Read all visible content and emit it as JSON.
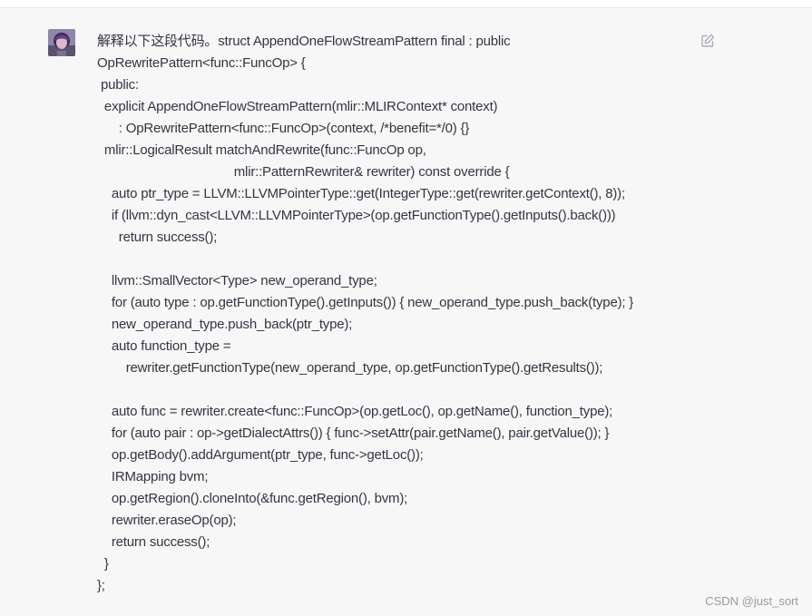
{
  "message": {
    "lines": [
      "解释以下这段代码。struct AppendOneFlowStreamPattern final : public",
      "OpRewritePattern<func::FuncOp> {",
      " public:",
      "  explicit AppendOneFlowStreamPattern(mlir::MLIRContext* context)",
      "      : OpRewritePattern<func::FuncOp>(context, /*benefit=*/0) {}",
      "  mlir::LogicalResult matchAndRewrite(func::FuncOp op,",
      "                                      mlir::PatternRewriter& rewriter) const override {",
      "    auto ptr_type = LLVM::LLVMPointerType::get(IntegerType::get(rewriter.getContext(), 8));",
      "    if (llvm::dyn_cast<LLVM::LLVMPointerType>(op.getFunctionType().getInputs().back()))",
      "      return success();",
      "",
      "    llvm::SmallVector<Type> new_operand_type;",
      "    for (auto type : op.getFunctionType().getInputs()) { new_operand_type.push_back(type); }",
      "    new_operand_type.push_back(ptr_type);",
      "    auto function_type =",
      "        rewriter.getFunctionType(new_operand_type, op.getFunctionType().getResults());",
      "",
      "    auto func = rewriter.create<func::FuncOp>(op.getLoc(), op.getName(), function_type);",
      "    for (auto pair : op->getDialectAttrs()) { func->setAttr(pair.getName(), pair.getValue()); }",
      "    op.getBody().addArgument(ptr_type, func->getLoc());",
      "    IRMapping bvm;",
      "    op.getRegion().cloneInto(&func.getRegion(), bvm);",
      "    rewriter.eraseOp(op);",
      "    return success();",
      "  }",
      "};"
    ]
  },
  "icons": {
    "avatar": "user-avatar",
    "edit": "edit-icon"
  },
  "watermark": "CSDN @just_sort",
  "colors": {
    "background": "#f7f7f8",
    "text": "#343541",
    "icon": "#acacbe",
    "watermark": "#9a9a9a"
  }
}
